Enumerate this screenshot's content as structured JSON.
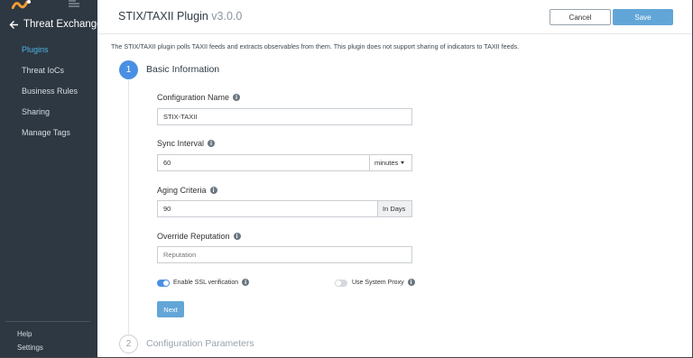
{
  "sidebar": {
    "brand": "Threat Exchange",
    "items": [
      {
        "label": "Plugins",
        "active": true
      },
      {
        "label": "Threat IoCs",
        "active": false
      },
      {
        "label": "Business Rules",
        "active": false
      },
      {
        "label": "Sharing",
        "active": false
      },
      {
        "label": "Manage Tags",
        "active": false
      }
    ],
    "bottom": {
      "help": "Help",
      "settings": "Settings"
    }
  },
  "header": {
    "title": "STIX/TAXII Plugin",
    "version": "v3.0.0",
    "cancel_label": "Cancel",
    "save_label": "Save"
  },
  "description": "The STIX/TAXII plugin polls TAXII feeds and extracts observables from them. This plugin does not support sharing of indicators to TAXII feeds.",
  "steps": [
    {
      "number": "1",
      "title": "Basic Information",
      "active": true
    },
    {
      "number": "2",
      "title": "Configuration Parameters",
      "active": false
    }
  ],
  "form": {
    "config_name": {
      "label": "Configuration Name",
      "value": "STIX-TAXII"
    },
    "sync_interval": {
      "label": "Sync Interval",
      "value": "60",
      "unit": "minutes"
    },
    "aging_criteria": {
      "label": "Aging Criteria",
      "value": "90",
      "suffix": "In Days"
    },
    "override_reputation": {
      "label": "Override Reputation",
      "placeholder": "Reputation"
    },
    "ssl": {
      "label": "Enable SSL verification",
      "enabled": true
    },
    "proxy": {
      "label": "Use System Proxy",
      "enabled": false
    },
    "next_label": "Next",
    "info_glyph": "i"
  },
  "colors": {
    "sidebar_bg": "#2e3842",
    "accent": "#4a90e2",
    "button_blue": "#62a6d7",
    "active_nav": "#4cb3e6"
  }
}
